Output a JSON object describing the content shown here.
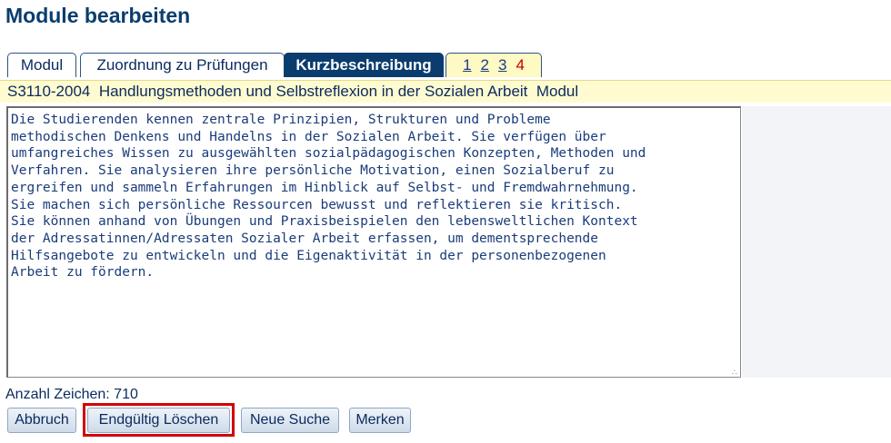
{
  "page": {
    "title": "Module bearbeiten"
  },
  "tabs": [
    {
      "label": "Modul",
      "active": false
    },
    {
      "label": "Zuordnung zu Prüfungen",
      "active": false
    },
    {
      "label": "Kurzbeschreibung",
      "active": true
    }
  ],
  "pager": {
    "links": [
      "1",
      "2",
      "3"
    ],
    "current": "4"
  },
  "module": {
    "header": "S3110-2004  Handlungsmethoden und Selbstreflexion in der Sozialen Arbeit  Modul"
  },
  "description": {
    "text": "Die Studierenden kennen zentrale Prinzipien, Strukturen und Probleme\nmethodischen Denkens und Handelns in der Sozialen Arbeit. Sie verfügen über\numfangreiches Wissen zu ausgewählten sozialpädagogischen Konzepten, Methoden und\nVerfahren. Sie analysieren ihre persönliche Motivation, einen Sozialberuf zu\nergreifen und sammeln Erfahrungen im Hinblick auf Selbst- und Fremdwahrnehmung.\nSie machen sich persönliche Ressourcen bewusst und reflektieren sie kritisch.\nSie können anhand von Übungen und Praxisbeispielen den lebensweltlichen Kontext\nder Adressatinnen/Adressaten Sozialer Arbeit erfassen, um dementsprechende\nHilfsangebote zu entwickeln und die Eigenaktivität in der personenbezogenen\nArbeit zu fördern.",
    "char_count_label": "Anzahl Zeichen: 710"
  },
  "buttons": {
    "cancel": "Abbruch",
    "delete": "Endgültig Löschen",
    "new_search": "Neue Suche",
    "remember": "Merken"
  },
  "colors": {
    "accent": "#0a3d6e",
    "highlight": "#d40000",
    "header_bg": "#fffbd0"
  }
}
